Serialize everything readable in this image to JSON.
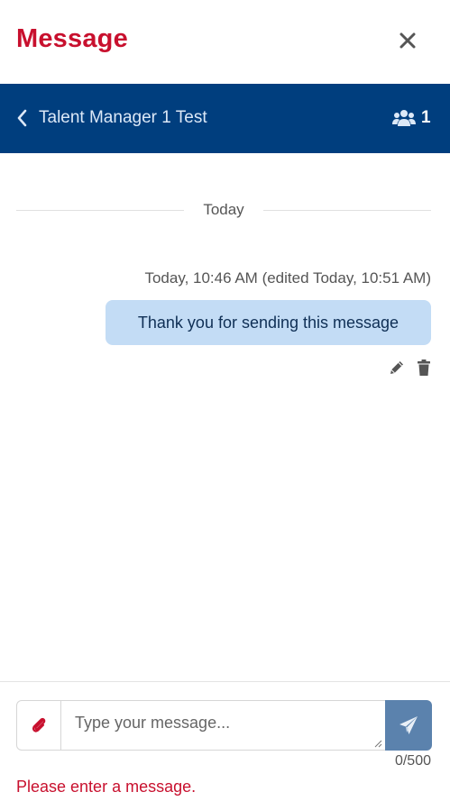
{
  "header": {
    "title": "Message",
    "close_icon": "close-icon"
  },
  "conversation": {
    "name": "Talent Manager 1 Test",
    "participant_count": "1",
    "back_icon": "chevron-left-icon",
    "participants_icon": "users-icon"
  },
  "divider": {
    "label": "Today"
  },
  "messages": [
    {
      "meta": "Today, 10:46 AM  (edited Today, 10:51 AM)",
      "text": "Thank you for sending this message",
      "actions": [
        "pencil-icon",
        "trash-icon"
      ]
    }
  ],
  "composer": {
    "placeholder": "Type your message...",
    "value": "",
    "char_count": "0/500",
    "attach_icon": "paperclip-icon",
    "send_icon": "paper-plane-icon",
    "error": "Please enter a message."
  },
  "colors": {
    "brand_red": "#c8102e",
    "bar_blue": "#003e7e",
    "bubble_blue": "#c3dcf5",
    "send_button": "#5b82ad"
  }
}
